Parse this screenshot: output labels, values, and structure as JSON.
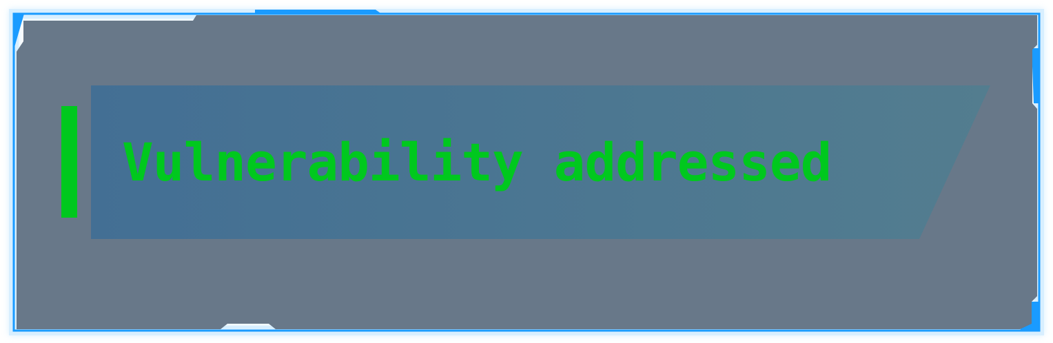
{
  "notification": {
    "message": "Vulnerability addressed",
    "status": "success"
  },
  "colors": {
    "frame_border": "#1a9bff",
    "frame_glow": "#bfe6ff",
    "panel_fill": "#687889",
    "banner_start": "#436f94",
    "banner_end": "#537d8f",
    "accent": "#00c81e",
    "text": "#00c81e"
  }
}
